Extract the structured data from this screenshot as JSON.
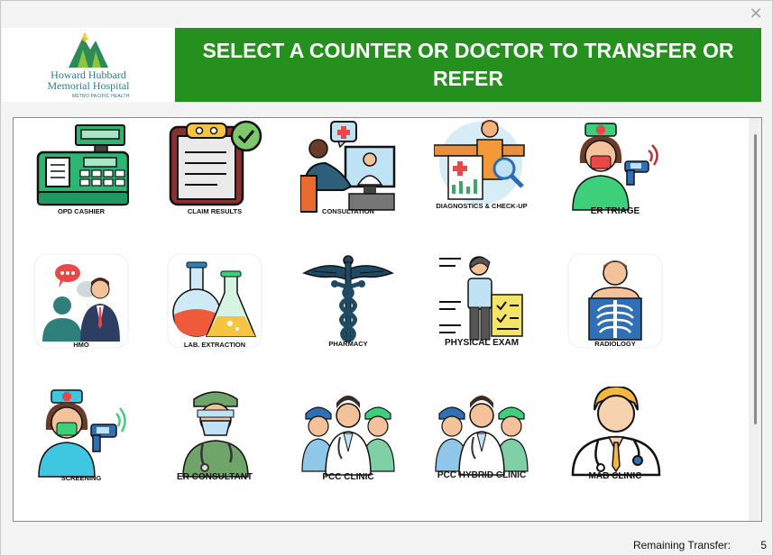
{
  "window": {
    "close_glyph": "×"
  },
  "logo": {
    "line1": "Howard Hubbard",
    "line2": "Memorial Hospital",
    "sub": "METRO PACIFIC HEALTH"
  },
  "header": {
    "title": "SELECT A COUNTER OR DOCTOR TO TRANSFER OR REFER"
  },
  "tiles": [
    {
      "label": "OPD CASHIER",
      "icon": "cash-register-icon"
    },
    {
      "label": "CLAIM RESULTS",
      "icon": "clipboard-check-icon"
    },
    {
      "label": "CONSULTATION",
      "icon": "telemedicine-icon"
    },
    {
      "label": "DIAGNOSTICS & CHECK-UP",
      "icon": "diagnostics-icon"
    },
    {
      "label": "ER TRIAGE",
      "icon": "nurse-thermometer-icon"
    },
    {
      "label": "HMO",
      "icon": "people-chat-icon"
    },
    {
      "label": "LAB. EXTRACTION",
      "icon": "lab-flask-icon"
    },
    {
      "label": "PHARMACY",
      "icon": "caduceus-icon"
    },
    {
      "label": "PHYSICAL EXAM",
      "icon": "physical-exam-icon"
    },
    {
      "label": "RADIOLOGY",
      "icon": "xray-icon"
    },
    {
      "label": "SCREENING",
      "icon": "nurse-scanner-icon"
    },
    {
      "label": "ER CONSULTANT",
      "icon": "surgeon-icon"
    },
    {
      "label": "PCC CLINIC",
      "icon": "medical-team-icon"
    },
    {
      "label": "PCC HYBRID CLINIC",
      "icon": "medical-team-icon"
    },
    {
      "label": "MAB CLINIC",
      "icon": "doctor-icon"
    }
  ],
  "status": {
    "label": "Remaining Transfer:",
    "count": "5"
  },
  "colors": {
    "banner": "#26901f",
    "logo_text": "#2f7e8d"
  }
}
